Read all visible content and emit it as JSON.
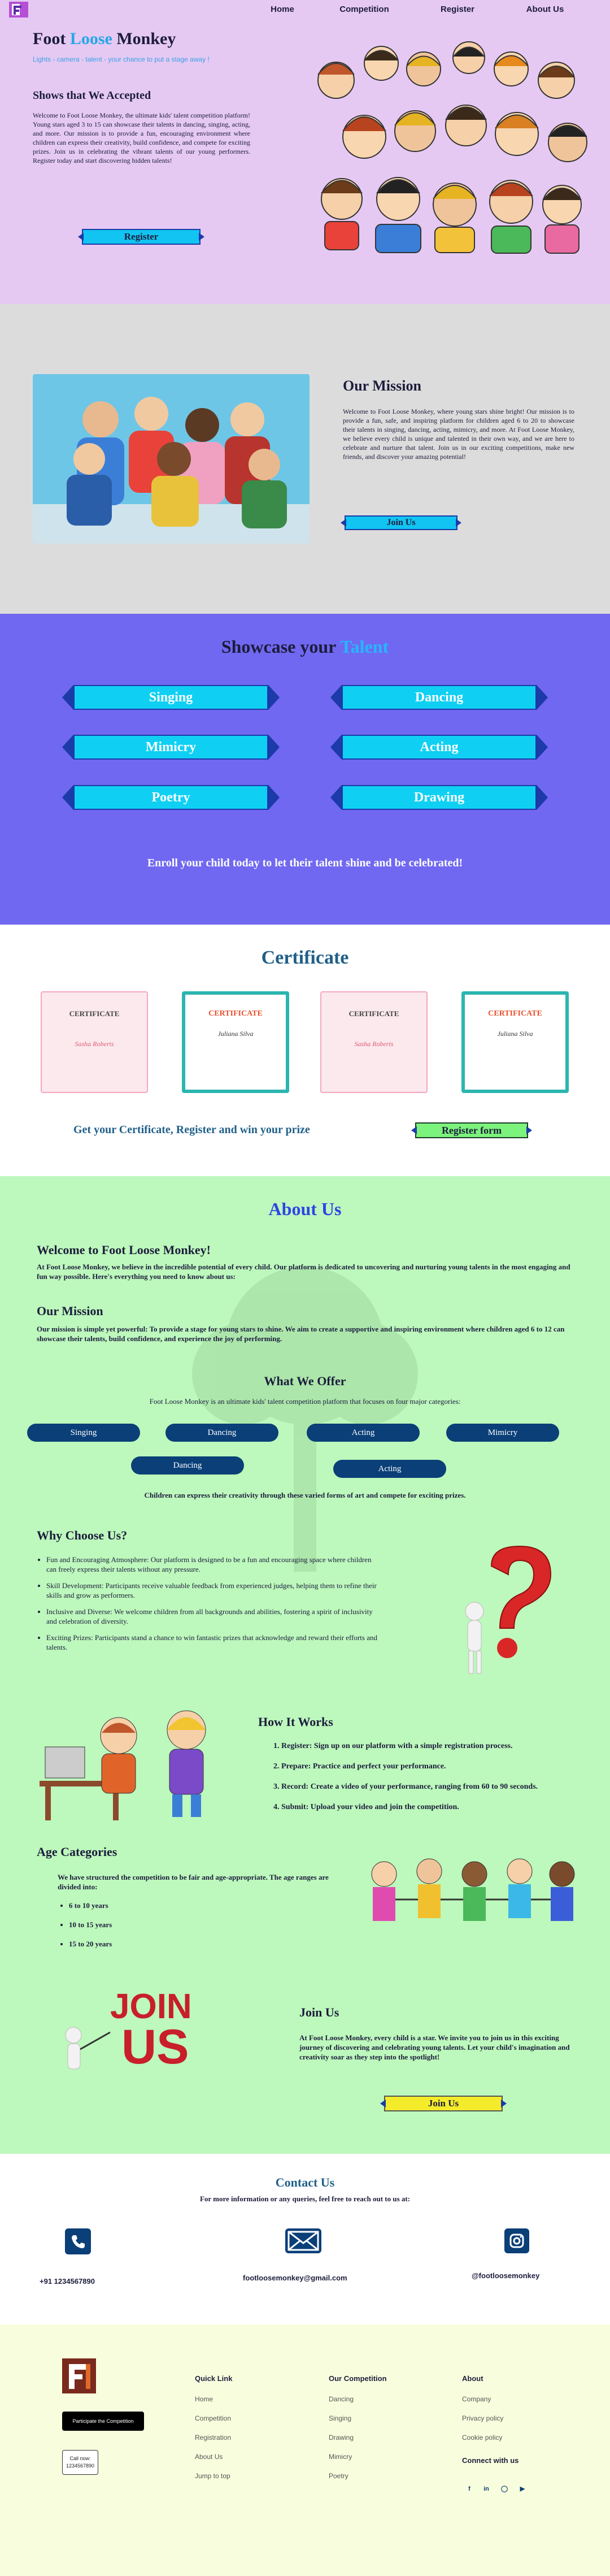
{
  "nav": {
    "items": [
      "Home",
      "Competition",
      "Register",
      "About Us"
    ]
  },
  "hero": {
    "title_a": "Foot ",
    "title_b": "Loose",
    "title_c": " Monkey",
    "tagline": "Lights - camera - talent - your chance to put a stage away !",
    "subtitle": "Shows that We Accepted",
    "description": "Welcome to Foot Loose Monkey, the ultimate kids' talent competition platform! Young stars aged 3 to 15 can showcase their talents in dancing, singing, acting, and more. Our mission is to provide a fun, encouraging environment where children can express their creativity, build confidence, and compete for exciting prizes. Join us in celebrating the vibrant talents of our young performers. Register today and start discovering hidden talents!",
    "register_button": "Register"
  },
  "mission": {
    "title": "Our Mission",
    "text": "Welcome to Foot Loose Monkey, where young stars shine bright! Our mission is to provide a fun, safe, and inspiring platform for children aged 6 to 20 to showcase their talents in singing, dancing, acting, mimicry, and more. At Foot Loose Monkey, we believe every child is unique and talented in their own way, and we are here to celebrate and nurture that talent. Join us in our exciting competitions, make new friends, and discover your amazing potential!",
    "join_button": "Join Us"
  },
  "showcase": {
    "title_a": "Showcase your ",
    "title_b": "Talent",
    "talents": [
      "Singing",
      "Dancing",
      "Mimicry",
      "Acting",
      "Poetry",
      "Drawing"
    ],
    "enroll": "Enroll your child today to let their talent shine and be celebrated!"
  },
  "certificate": {
    "title": "Certificate",
    "cards": [
      {
        "heading": "CERTIFICATE",
        "name": "Sasha Roberts"
      },
      {
        "heading": "CERTIFICATE",
        "name": "Juliana Silva"
      },
      {
        "heading": "CERTIFICATE",
        "name": "Sasha Roberts"
      },
      {
        "heading": "CERTIFICATE",
        "name": "Juliana Silva"
      }
    ],
    "prize_text": "Get your Certificate, Register and win your prize",
    "register_button": "Register form"
  },
  "about": {
    "title": "About Us",
    "welcome": "Welcome to Foot Loose Monkey!",
    "welcome_text": "At Foot Loose Monkey, we believe in the incredible potential of every child. Our platform is dedicated to uncovering and nurturing young talents in the most engaging and fun way possible. Here's everything you need to know about us:",
    "mission_title": "Our Mission",
    "mission_text": "Our mission is simple yet powerful: To provide a stage for young stars to shine. We aim to create a supportive and inspiring environment where children aged 6 to 12 can showcase their talents, build confidence, and experience the joy of performing.",
    "offer_title": "What We Offer",
    "offer_text": "Foot Loose Monkey is an ultimate kids' talent competition platform that focuses on four major categories:",
    "offer_pills": [
      "Singing",
      "Dancing",
      "Acting",
      "Mimicry",
      "Dancing",
      "Acting"
    ],
    "offer_footer": "Children can express their creativity through these varied forms of art and compete for exciting prizes.",
    "why_title": "Why Choose Us?",
    "why": [
      "Fun and Encouraging Atmosphere: Our platform is designed to be a fun and encouraging space where children can freely express their talents without any pressure.",
      "Skill Development: Participants receive valuable feedback from experienced judges, helping them to refine their skills and grow as performers.",
      "Inclusive and Diverse: We welcome children from all backgrounds and abilities, fostering a spirit of inclusivity and celebration of diversity.",
      "Exciting Prizes: Participants stand a chance to win fantastic prizes that acknowledge and reward their efforts and talents."
    ],
    "how_title": "How It Works",
    "how": [
      "Register: Sign up on our platform with a simple registration process.",
      "Prepare: Practice and perfect your performance.",
      "Record: Create a video of your performance, ranging from 60 to 90 seconds.",
      "Submit: Upload your video and join the competition."
    ],
    "age_title": "Age Categories",
    "age_text": "We have structured the competition to be fair and age-appropriate. The age ranges are divided into:",
    "ages": [
      "6 to 10 years",
      "10 to 15 years",
      "15 to 20 years"
    ],
    "join_title": "Join Us",
    "join_text": "At Foot Loose Monkey, every child is a star. We invite you to join us in this exciting journey of discovering and celebrating young talents. Let your child's imagination and creativity soar as they step into the spotlight!",
    "join_button": "Join Us",
    "join_graphic_a": "JOIN",
    "join_graphic_b": "US"
  },
  "contact": {
    "title": "Contact Us",
    "subtitle": "For more information or any queries, feel free to reach out to us at:",
    "phone": "+91 1234567890",
    "email": "footloosemonkey@gmail.com",
    "instagram": "@footloosemonkey"
  },
  "footer": {
    "participate_button": "Participate the Competition",
    "call_button_a": "Call now:",
    "call_button_b": "1234567890",
    "quick_link_title": "Quick Link",
    "quick_links": [
      "Home",
      "Competition",
      "Registration",
      "About Us",
      "Jump to top"
    ],
    "competition_title": "Our Competition",
    "competitions": [
      "Dancing",
      "Singing",
      "Drawing",
      "Mimicry",
      "Poetry"
    ],
    "about_title": "About",
    "about_links": [
      "Company",
      "Privacy policy",
      "Cookie policy"
    ],
    "connect_title": "Connect with us",
    "social_icons": [
      "facebook-icon",
      "linkedin-icon",
      "instagram-icon",
      "youtube-icon"
    ]
  },
  "colors": {
    "hero_bg": "#e5c9f3",
    "mission_bg": "#dcdcdc",
    "showcase_bg": "#7068f0",
    "about_bg": "#bdf8bc",
    "footer_bg": "#f8fedd",
    "ribbon": "#11c4f2",
    "navy": "#0a3f78"
  }
}
